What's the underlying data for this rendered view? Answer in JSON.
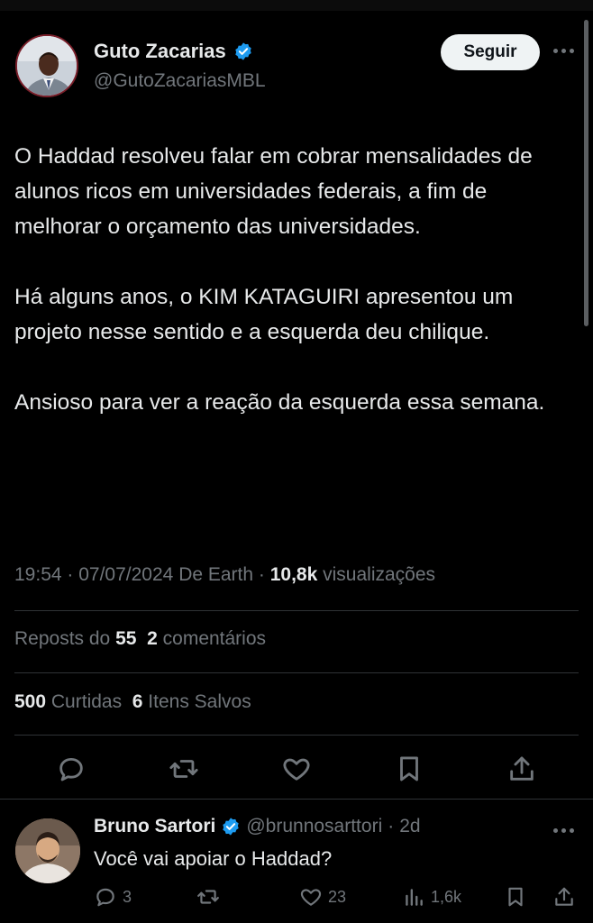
{
  "author": {
    "name": "Guto Zacarias",
    "handle": "@GutoZacariasMBL",
    "verified": true
  },
  "follow_label": "Seguir",
  "tweet": {
    "paragraphs": [
      "O Haddad resolveu falar em cobrar mensalidades de alunos ricos em universidades federais, a fim de melhorar o orçamento das universidades.",
      "Há alguns anos, o KIM KATAGUIRI apresentou um projeto nesse sentido e a esquerda deu chilique.",
      "Ansioso para ver a reação da esquerda essa semana."
    ],
    "time": "19:54",
    "date": "07/07/2024",
    "source": "De Earth",
    "views": "10,8k",
    "views_label": "visualizações"
  },
  "stats": {
    "reposts_label": "Reposts do",
    "reposts": "55",
    "comments": "2",
    "comments_label": "comentários",
    "likes": "500",
    "likes_label": "Curtidas",
    "saves": "6",
    "saves_label": "Itens Salvos"
  },
  "actions": [
    "reply-icon",
    "repost-icon",
    "like-icon",
    "bookmark-icon",
    "share-icon"
  ],
  "reply": {
    "name": "Bruno Sartori",
    "handle": "@brunnosarttori",
    "time": "2d",
    "text": "Você vai apoiar o Haddad?",
    "replies": "3",
    "likes": "23",
    "views": "1,6k"
  },
  "colors": {
    "background": "#000000",
    "text": "#e7e9ea",
    "muted": "#71767b",
    "verified": "#1d9bf0",
    "divider": "#2f3336"
  }
}
